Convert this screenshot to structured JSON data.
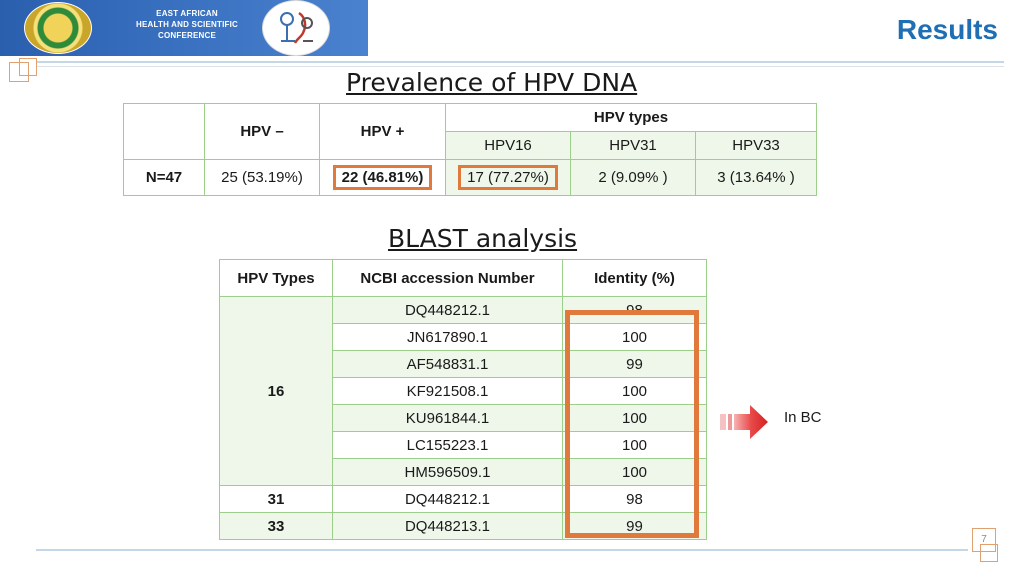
{
  "banner": {
    "text_line1": "EAST AFRICAN",
    "text_line2": "HEALTH AND SCIENTIFIC CONFERENCE",
    "left_logo": "eac-emblem-icon",
    "right_logo": "microscope-logo-icon"
  },
  "header": {
    "title": "Results"
  },
  "section1": {
    "heading": "Prevalence of HPV DNA"
  },
  "table1": {
    "col_hpv_neg": "HPV –",
    "col_hpv_pos": "HPV +",
    "col_types": "HPV types",
    "types": [
      "HPV16",
      "HPV31",
      "HPV33"
    ],
    "row_label": "N=47",
    "values": [
      "25 (53.19%)",
      "22 (46.81%)",
      "17 (77.27%)",
      "2 (9.09% )",
      "3 (13.64% )"
    ]
  },
  "section2": {
    "heading": "BLAST analysis "
  },
  "table2": {
    "headers": [
      "HPV Types",
      "NCBI accession Number",
      "Identity (%)"
    ],
    "group16": "16",
    "rows16": [
      {
        "acc": "DQ448212.1",
        "id": "98"
      },
      {
        "acc": "JN617890.1",
        "id": "100"
      },
      {
        "acc": "AF548831.1",
        "id": "99"
      },
      {
        "acc": "KF921508.1",
        "id": "100"
      },
      {
        "acc": "KU961844.1",
        "id": "100"
      },
      {
        "acc": "LC155223.1",
        "id": "100"
      },
      {
        "acc": "HM596509.1",
        "id": "100"
      }
    ],
    "row31": {
      "type": "31",
      "acc": "DQ448212.1",
      "id": "98"
    },
    "row33": {
      "type": "33",
      "acc": "DQ448213.1",
      "id": "99"
    }
  },
  "annotation": {
    "label": "In BC",
    "arrow_icon": "right-arrow-icon"
  },
  "footer": {
    "page_number": "7"
  },
  "colors": {
    "title_blue": "#1f6fb5",
    "highlight_orange": "#e07a3c",
    "table_border": "#9ccf8a",
    "banner_blue": "#2a5fae"
  }
}
